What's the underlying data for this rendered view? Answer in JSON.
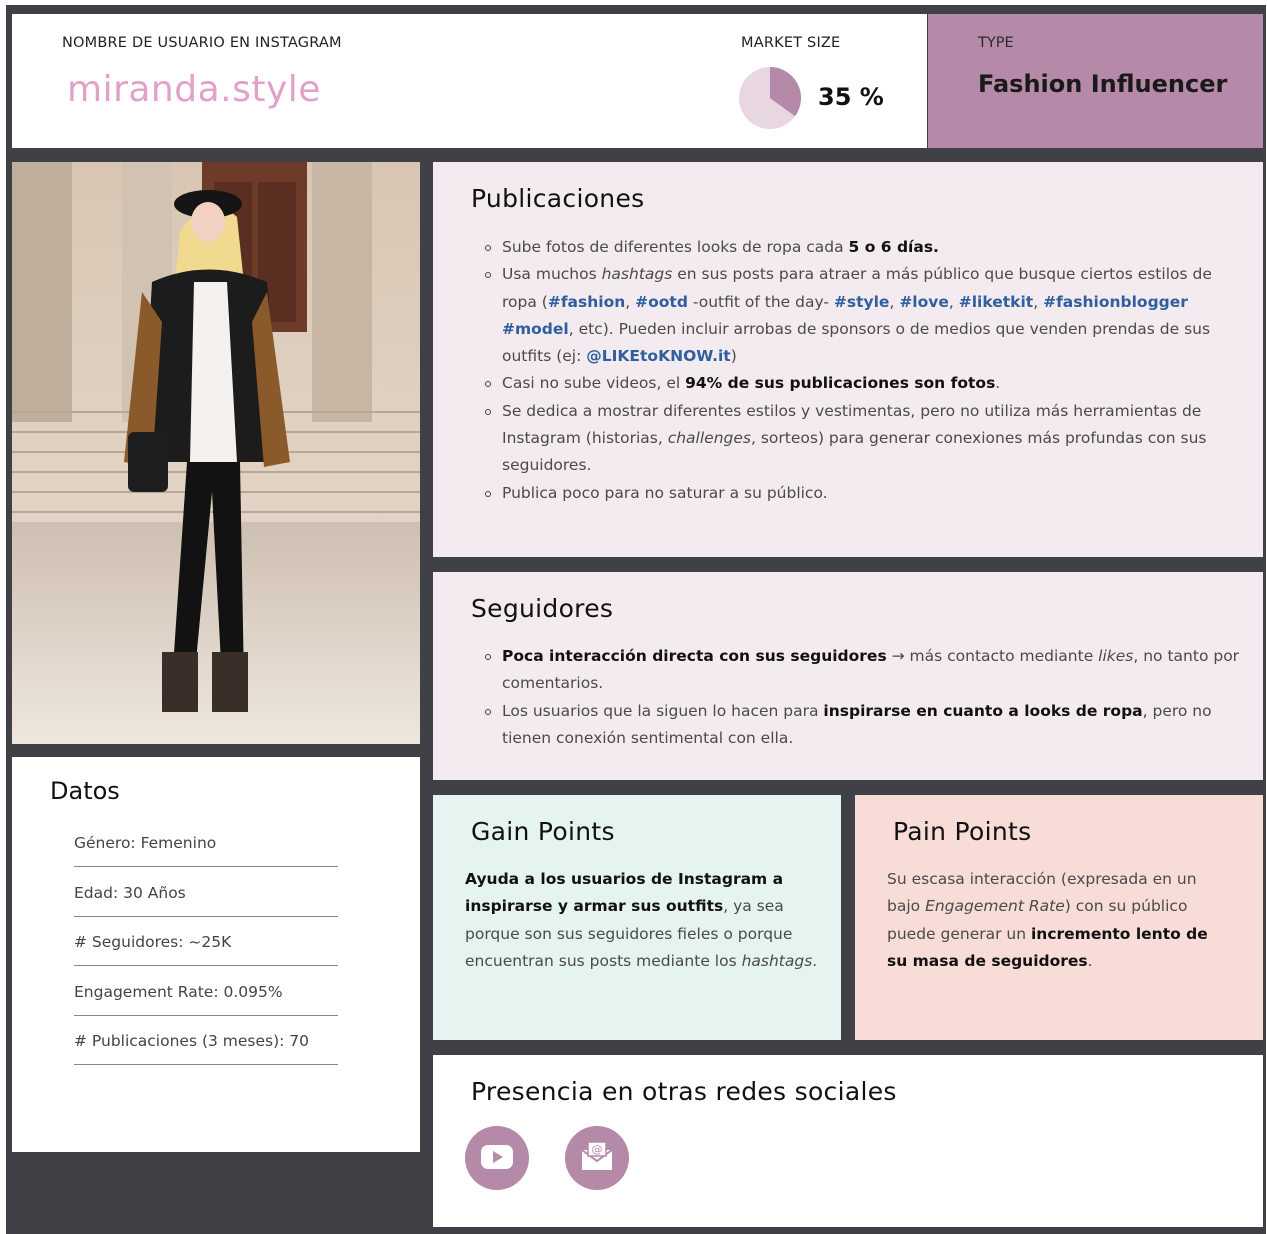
{
  "header": {
    "username_label": "NOMBRE DE USUARIO EN INSTAGRAM",
    "username": "miranda.style",
    "market_label": "MARKET SIZE",
    "market_value": "35 %",
    "market_fraction": 0.35,
    "type_label": "TYPE",
    "type_value": "Fashion Influencer"
  },
  "colors": {
    "accent": "#b589a8",
    "username": "#e3a0c8",
    "hashtag": "#2f5f9e",
    "frame": "#3f4147"
  },
  "datos": {
    "title": "Datos",
    "rows": [
      "Género: Femenino",
      "Edad: 30 Años",
      "# Seguidores: ~25K",
      "Engagement Rate: 0.095%",
      "# Publicaciones (3 meses): 70"
    ]
  },
  "publicaciones": {
    "title": "Publicaciones",
    "b1_a": "Sube fotos de diferentes looks de ropa cada ",
    "b1_b": "5 o 6 días.",
    "b2_a": "Usa muchos ",
    "b2_b": "hashtags",
    "b2_c": " en sus posts para atraer a más público que busque ciertos estilos de ropa (",
    "b2_tag1": "#fashion",
    "b2_sep1": ", ",
    "b2_tag2": "#ootd",
    "b2_d": " -outfit of the day- ",
    "b2_tag3": "#style",
    "b2_sep2": ", ",
    "b2_tag4": "#love",
    "b2_sep3": ", ",
    "b2_tag5": "#liketkit",
    "b2_sep4": ", ",
    "b2_tag6": "#fashionblogger",
    "b2_sep5": " ",
    "b2_tag7": "#model",
    "b2_e": ", etc). Pueden incluir arrobas de sponsors o de medios que venden prendas de sus outfits (ej: ",
    "b2_tag8": "@LIKEtoKNOW.it",
    "b2_f": ")",
    "b3_a": "Casi no sube videos, el ",
    "b3_b": "94% de sus publicaciones son fotos",
    "b3_c": ".",
    "b4_a": "Se dedica a mostrar diferentes estilos y vestimentas, pero no utiliza más herramientas de Instagram (historias, ",
    "b4_b": "challenges",
    "b4_c": ", sorteos) para generar conexiones más profundas con sus seguidores.",
    "b5": "Publica poco para no saturar a su público."
  },
  "seguidores": {
    "title": "Seguidores",
    "b1_a": "Poca interacción directa con sus seguidores",
    "b1_b": " → más contacto mediante ",
    "b1_c": "likes",
    "b1_d": ", no tanto por comentarios.",
    "b2_a": "Los usuarios que la siguen lo hacen para ",
    "b2_b": "inspirarse en cuanto a looks de ropa",
    "b2_c": ", pero no tienen conexión sentimental con ella."
  },
  "gain": {
    "title": "Gain Points",
    "a": "Ayuda a los usuarios de Instagram a inspirarse y armar sus outfits",
    "b": ", ya sea porque son sus seguidores fieles o porque encuentran sus posts mediante los ",
    "c": "hashtags",
    "d": "."
  },
  "pain": {
    "title": "Pain Points",
    "a": "Su escasa interacción (expresada en un bajo ",
    "b": "Engagement Rate",
    "c": ") con su público puede generar un ",
    "d": "incremento lento de su masa de seguidores",
    "e": "."
  },
  "presencia": {
    "title": "Presencia en otras redes sociales",
    "icons": [
      "youtube-icon",
      "email-icon"
    ]
  }
}
